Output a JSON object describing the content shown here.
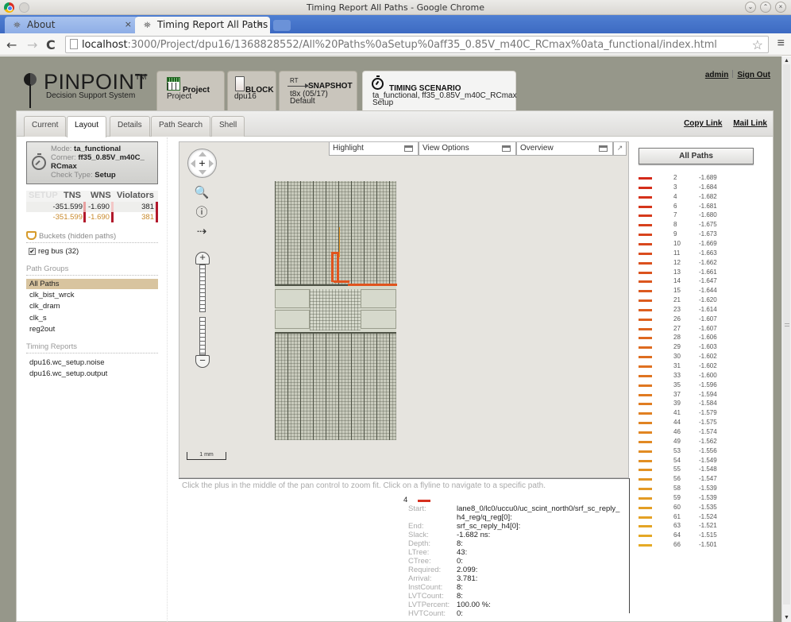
{
  "window": {
    "title": "Timing Report All Paths - Google Chrome",
    "controls": [
      "minimize",
      "maximize",
      "close"
    ]
  },
  "browser": {
    "tabs": [
      {
        "label": "About",
        "active": false
      },
      {
        "label": "Timing Report All Paths",
        "active": true
      }
    ],
    "url_host": "localhost",
    "url_rest": ":3000/Project/dpu16/1368828552/All%20Paths%0aSetup%0aff35_0.85V_m40C_RCmax%0ata_functional/index.html"
  },
  "header": {
    "brand": "PINPOINT",
    "trademark": "TM",
    "tagline": "Decision Support System",
    "context_tabs": [
      {
        "title": "Project",
        "line1": "Project",
        "line2": ""
      },
      {
        "title": "BLOCK",
        "line1": "dpu16",
        "line2": ""
      },
      {
        "title": "SNAPSHOT",
        "prefix": "RT",
        "line1": "t8x (05/17)",
        "line2": "Default"
      },
      {
        "title": "TIMING SCENARIO",
        "line1": "ta_functional, ff35_0.85V_m40C_RCmax",
        "line2": "Setup"
      }
    ],
    "user": "admin",
    "sign_out": "Sign Out"
  },
  "subnav": {
    "tabs": [
      "Current",
      "Layout",
      "Details",
      "Path Search",
      "Shell"
    ],
    "active_tab": "Layout",
    "copy_link": "Copy Link",
    "mail_link": "Mail Link"
  },
  "scenario": {
    "mode_label": "Mode:",
    "mode": "ta_functional",
    "corner_label": "Corner:",
    "corner_1": "ff35_0.85V_m40C_",
    "corner_2": "RCmax",
    "check_label": "Check Type:",
    "check": "Setup"
  },
  "metrics": {
    "headers": [
      "SETUP",
      "TNS",
      "WNS",
      "Violators"
    ],
    "rows": [
      {
        "tns": "-351.599",
        "wns": "-1.690",
        "violators": "381"
      },
      {
        "tns": "-351.599",
        "wns": "-1.690",
        "violators": "381"
      }
    ],
    "bar_colors": {
      "light": "#e8a0a0",
      "dark": "#b2182b"
    }
  },
  "buckets": {
    "label": "Buckets (hidden paths)",
    "items": [
      {
        "label": "reg bus (32)",
        "checked": true
      }
    ]
  },
  "path_groups": {
    "label": "Path Groups",
    "items": [
      "All Paths",
      "clk_bist_wrck",
      "clk_dram",
      "clk_s",
      "reg2out"
    ],
    "selected": "All Paths"
  },
  "timing_reports": {
    "label": "Timing Reports",
    "items": [
      "dpu16.wc_setup.noise",
      "dpu16.wc_setup.output"
    ]
  },
  "layout_view": {
    "dropdowns": [
      "Highlight",
      "View Options",
      "Overview"
    ],
    "scale_label": "1 mm",
    "tools": [
      "pan-control",
      "zoom-box",
      "info",
      "flyline-tool"
    ],
    "zoom_level_fraction": 0.5,
    "hint": "Click the plus in the middle of the pan control to zoom fit. Click on a flyline to navigate to a specific path.",
    "flyline_color": "#e0541e"
  },
  "path_detail": {
    "id": "4",
    "line_color": "#d6301f",
    "fields": [
      {
        "key": "Start:",
        "value": "lane8_0/lc0/uccu0/uc_scint_north0/srf_sc_reply_",
        "value2": "h4_reg/q_reg[0]:"
      },
      {
        "key": "End:",
        "value": "srf_sc_reply_h4[0]:"
      },
      {
        "key": "Slack:",
        "value": "-1.682 ns:"
      },
      {
        "key": "Depth:",
        "value": "8:"
      },
      {
        "key": "LTree:",
        "value": "43:"
      },
      {
        "key": "CTree:",
        "value": "0:"
      },
      {
        "key": "Required:",
        "value": "2.099:"
      },
      {
        "key": "Arrival:",
        "value": "3.781:"
      },
      {
        "key": "InstCount:",
        "value": "8:"
      },
      {
        "key": "LVTCount:",
        "value": "8:"
      },
      {
        "key": "LVTPercent:",
        "value": "100.00 %:"
      },
      {
        "key": "HVTCount:",
        "value": "0:"
      }
    ]
  },
  "legend": {
    "button": "All Paths",
    "paths": [
      {
        "id": "2",
        "slack": "-1.689",
        "color": "#d42a1a"
      },
      {
        "id": "3",
        "slack": "-1.684",
        "color": "#d42e1a"
      },
      {
        "id": "4",
        "slack": "-1.682",
        "color": "#d5321b"
      },
      {
        "id": "6",
        "slack": "-1.681",
        "color": "#d5361b"
      },
      {
        "id": "7",
        "slack": "-1.680",
        "color": "#d63a1c"
      },
      {
        "id": "8",
        "slack": "-1.675",
        "color": "#d7401c"
      },
      {
        "id": "9",
        "slack": "-1.673",
        "color": "#d8441d"
      },
      {
        "id": "10",
        "slack": "-1.669",
        "color": "#d9481d"
      },
      {
        "id": "11",
        "slack": "-1.663",
        "color": "#da4c1e"
      },
      {
        "id": "12",
        "slack": "-1.662",
        "color": "#db501e"
      },
      {
        "id": "13",
        "slack": "-1.661",
        "color": "#db531e"
      },
      {
        "id": "14",
        "slack": "-1.647",
        "color": "#dc561e"
      },
      {
        "id": "15",
        "slack": "-1.644",
        "color": "#dc591f"
      },
      {
        "id": "21",
        "slack": "-1.620",
        "color": "#dc5c1f"
      },
      {
        "id": "23",
        "slack": "-1.614",
        "color": "#dd5f1f"
      },
      {
        "id": "26",
        "slack": "-1.607",
        "color": "#dd621f"
      },
      {
        "id": "27",
        "slack": "-1.607",
        "color": "#dd6520"
      },
      {
        "id": "28",
        "slack": "-1.606",
        "color": "#de6820"
      },
      {
        "id": "29",
        "slack": "-1.603",
        "color": "#de6b20"
      },
      {
        "id": "30",
        "slack": "-1.602",
        "color": "#de6e20"
      },
      {
        "id": "31",
        "slack": "-1.602",
        "color": "#df7121"
      },
      {
        "id": "33",
        "slack": "-1.600",
        "color": "#df7421"
      },
      {
        "id": "35",
        "slack": "-1.596",
        "color": "#df7721"
      },
      {
        "id": "37",
        "slack": "-1.594",
        "color": "#e07a21"
      },
      {
        "id": "39",
        "slack": "-1.584",
        "color": "#e07d22"
      },
      {
        "id": "41",
        "slack": "-1.579",
        "color": "#e08022"
      },
      {
        "id": "44",
        "slack": "-1.575",
        "color": "#e08322"
      },
      {
        "id": "46",
        "slack": "-1.574",
        "color": "#e18622"
      },
      {
        "id": "49",
        "slack": "-1.562",
        "color": "#e18923"
      },
      {
        "id": "53",
        "slack": "-1.556",
        "color": "#e18c23"
      },
      {
        "id": "54",
        "slack": "-1.549",
        "color": "#e28f23"
      },
      {
        "id": "55",
        "slack": "-1.548",
        "color": "#e29223"
      },
      {
        "id": "56",
        "slack": "-1.547",
        "color": "#e29524"
      },
      {
        "id": "58",
        "slack": "-1.539",
        "color": "#e39824"
      },
      {
        "id": "59",
        "slack": "-1.539",
        "color": "#e39b24"
      },
      {
        "id": "60",
        "slack": "-1.535",
        "color": "#e39e24"
      },
      {
        "id": "61",
        "slack": "-1.524",
        "color": "#e4a125"
      },
      {
        "id": "63",
        "slack": "-1.521",
        "color": "#e4a425"
      },
      {
        "id": "64",
        "slack": "-1.515",
        "color": "#e4a725"
      },
      {
        "id": "66",
        "slack": "-1.501",
        "color": "#e5aa26"
      }
    ]
  }
}
